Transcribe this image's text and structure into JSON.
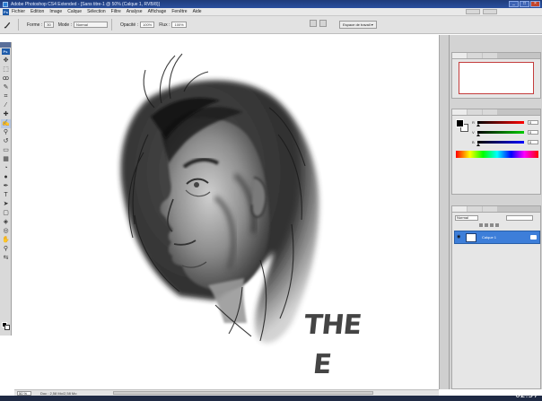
{
  "window": {
    "title": "Adobe Photoshop CS4 Extended - [Sans titre-1 @ 50% (Calque 1, RVB/8)]"
  },
  "menu": {
    "items": [
      "Fichier",
      "Edition",
      "Image",
      "Calque",
      "Sélection",
      "Filtre",
      "Analyse",
      "Affichage",
      "Fenêtre",
      "Aide"
    ]
  },
  "options": {
    "forme_label": "Forme :",
    "forme_value": "30",
    "mode_label": "Mode :",
    "mode_value": "Normal",
    "opacite_label": "Opacité :",
    "opacite_value": "100%",
    "flux_label": "Flux :",
    "flux_value": "100%",
    "workspace_label": "Espace de travail ▾"
  },
  "layers": {
    "opacity_field": "Normal",
    "layer_name": "Calque 1"
  },
  "status": {
    "zoom": "50 %",
    "doc": "Doc : 2,58 Mo/2,58 Mo"
  },
  "canvas": {
    "lettering_line1": "THE",
    "lettering_line2": "E"
  },
  "clock": "02:57"
}
